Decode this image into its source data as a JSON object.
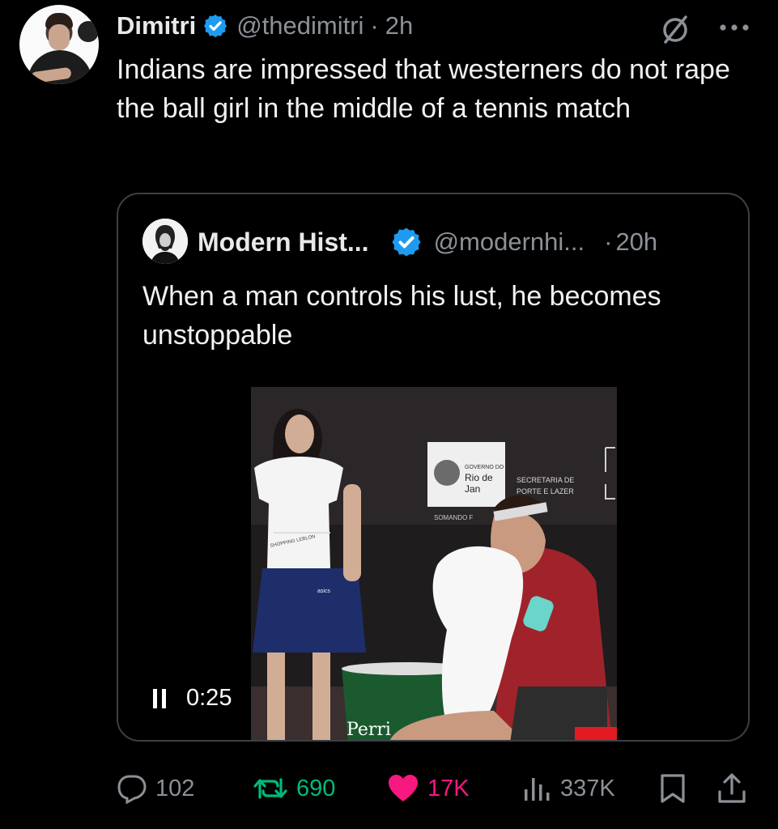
{
  "tweet": {
    "author_name": "Dimitri",
    "handle": "@thedimitri",
    "separator": "·",
    "time": "2h",
    "text": "Indians are impressed that westerners do not rape the ball girl in the middle of a tennis match"
  },
  "quoted": {
    "author_name": "Modern Hist...",
    "handle": "@modernhi...",
    "separator": "·",
    "time": "20h",
    "text": "When a man controls his lust, he becomes unstoppable",
    "video": {
      "elapsed": "0:25",
      "playback_state": "playing",
      "scene_signage": {
        "governo": "GOVERNO DO",
        "city_line_1": "Rio de",
        "city_line_2": "Jan",
        "secretaria_1": "SECRETARIA DE",
        "secretaria_2": "PORTE E LAZER",
        "somando": "SOMANDO F",
        "shirt_logo": "SHOPPING LEBLON",
        "skirt_logo": "asics",
        "bucket_brand": "Perri"
      }
    }
  },
  "actions": {
    "replies": "102",
    "reposts": "690",
    "likes": "17K",
    "views": "337K"
  },
  "icons": [
    "verified-badge-icon",
    "grok-icon",
    "more-icon",
    "pause-icon",
    "reply-icon",
    "repost-icon",
    "like-icon",
    "views-icon",
    "bookmark-icon",
    "share-icon"
  ],
  "colors": {
    "background": "#000000",
    "text_primary": "#e7e9ea",
    "text_secondary": "#8b9197",
    "verified_blue": "#1d9bf0",
    "repost_green": "#00ba7c",
    "like_pink": "#f91880",
    "border": "#3c4044"
  }
}
